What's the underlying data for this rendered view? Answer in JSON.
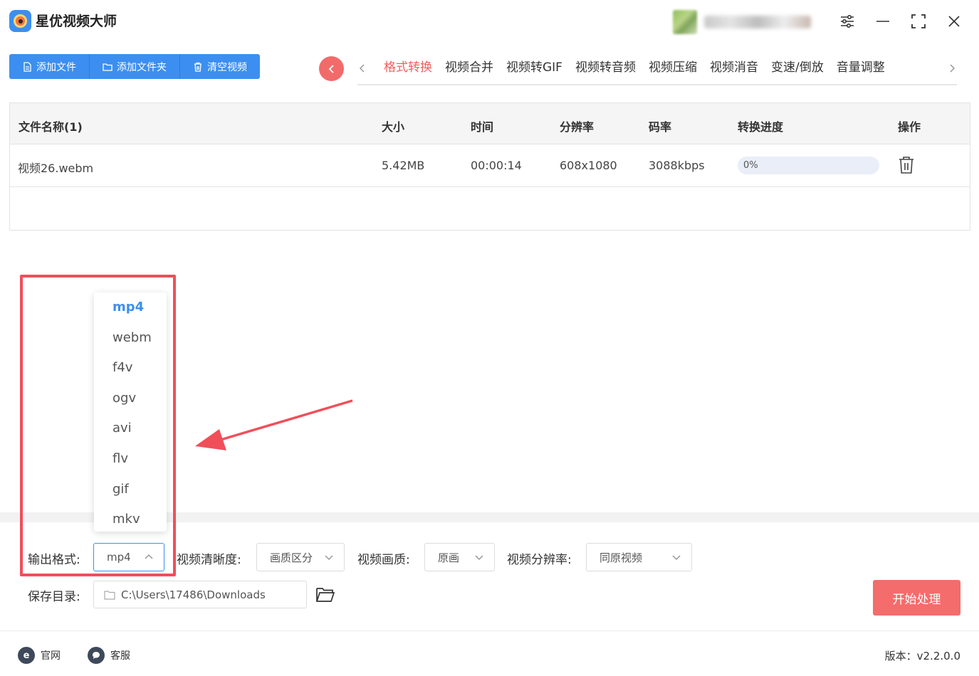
{
  "app": {
    "title": "星优视频大师",
    "version_label": "版本：v2.2.0.0"
  },
  "toolbar": {
    "add_file": "添加文件",
    "add_folder": "添加文件夹",
    "clear_videos": "清空视频"
  },
  "tabs": [
    "格式转换",
    "视频合并",
    "视频转GIF",
    "视频转音频",
    "视频压缩",
    "视频消音",
    "变速/倒放",
    "音量调整"
  ],
  "active_tab": "格式转换",
  "table": {
    "headers": [
      "文件名称(1)",
      "大小",
      "时间",
      "分辨率",
      "码率",
      "转换进度",
      "操作"
    ],
    "rows": [
      {
        "name": "视频26.webm",
        "size": "5.42MB",
        "duration": "00:00:14",
        "resolution": "608x1080",
        "bitrate": "3088kbps",
        "progress_text": "0%",
        "progress": 0
      }
    ]
  },
  "format_dropdown": {
    "options": [
      "mp4",
      "webm",
      "f4v",
      "ogv",
      "avi",
      "flv",
      "gif",
      "mkv"
    ],
    "selected": "mp4"
  },
  "settings": {
    "output_format_label": "输出格式:",
    "output_format_value": "mp4",
    "clarity_label": "视频清晰度:",
    "clarity_value": "画质区分",
    "quality_label": "视频画质:",
    "quality_value": "原画",
    "resolution_label": "视频分辨率:",
    "resolution_value": "同原视频",
    "save_dir_label": "保存目录:",
    "save_dir_value": "C:\\Users\\17486\\Downloads",
    "start_button": "开始处理"
  },
  "footer": {
    "website": "官网",
    "support": "客服"
  },
  "colors": {
    "primary": "#3c8ff0",
    "accent_red": "#f56c6c",
    "annotation_red": "#f04f5a"
  }
}
